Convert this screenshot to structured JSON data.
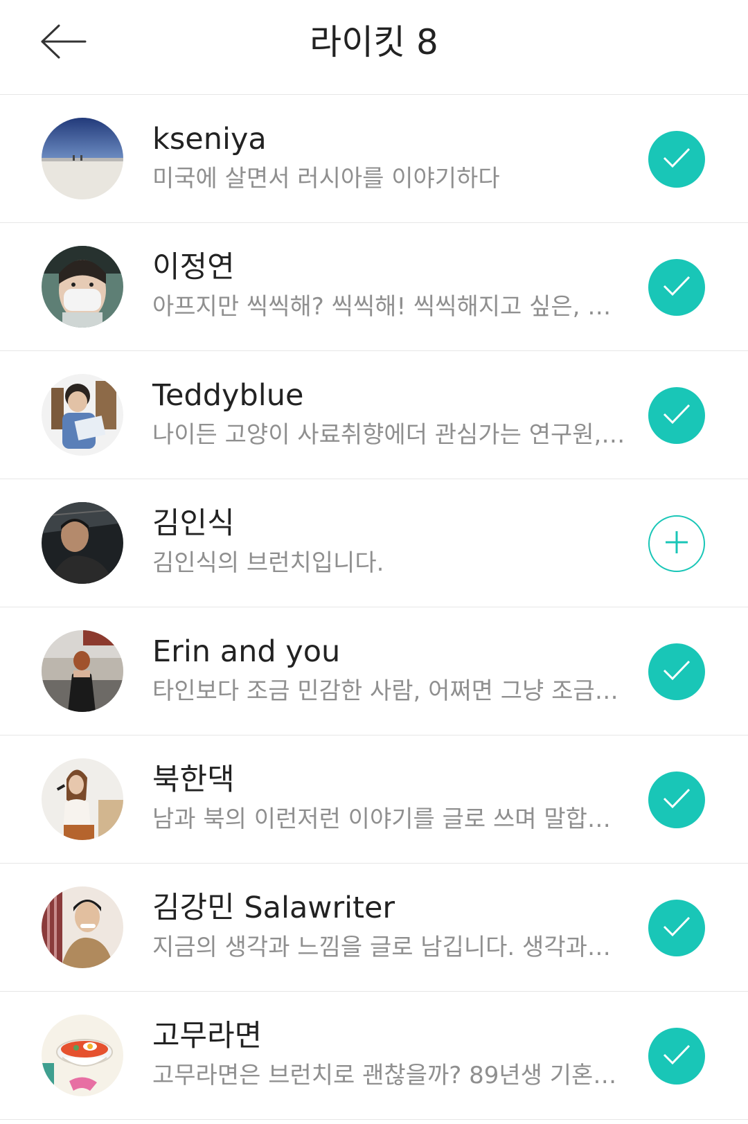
{
  "header": {
    "back_icon": "arrow-left-icon",
    "title": "라이킷 8"
  },
  "colors": {
    "accent": "#19c6b7",
    "name_text": "#222222",
    "desc_text": "#8f8f8f",
    "divider": "#e6e6e6"
  },
  "users": [
    {
      "name": "kseniya",
      "description": "미국에 살면서 러시아를 이야기하다",
      "followed": true,
      "action_icon": "check-icon"
    },
    {
      "name": "이정연",
      "description": "아프지만 씩씩해? 씩씩해! 씩씩해지고 싶은, …",
      "followed": true,
      "action_icon": "check-icon"
    },
    {
      "name": "Teddyblue",
      "description": "나이든 고양이 사료취향에더 관심가는 연구원, …",
      "followed": true,
      "action_icon": "check-icon"
    },
    {
      "name": "김인식",
      "description": "김인식의 브런치입니다.",
      "followed": false,
      "action_icon": "plus-icon"
    },
    {
      "name": "Erin and you",
      "description": "타인보다 조금 민감한 사람, 어쩌면 그냥 조금…",
      "followed": true,
      "action_icon": "check-icon"
    },
    {
      "name": "북한댁",
      "description": "남과 북의 이런저런 이야기를 글로 쓰며 말합니…",
      "followed": true,
      "action_icon": "check-icon"
    },
    {
      "name": "김강민 Salawriter",
      "description": "지금의 생각과 느낌을 글로 남깁니다. 생각과…",
      "followed": true,
      "action_icon": "check-icon"
    },
    {
      "name": "고무라면",
      "description": "고무라면은 브런치로 괜찮을까? 89년생 기혼…",
      "followed": true,
      "action_icon": "check-icon"
    }
  ]
}
